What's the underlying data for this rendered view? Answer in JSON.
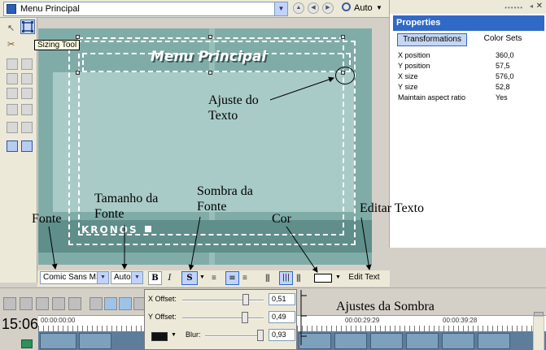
{
  "toolbar": {
    "menu_select_value": "Menu Principal",
    "zoom_value": "Auto"
  },
  "tooltip": "Sizing Tool",
  "canvas": {
    "title_text": "Menu Principal",
    "footer_logo": "KRONOS"
  },
  "properties": {
    "title": "Properties",
    "tabs": [
      "Transformations",
      "Color Sets"
    ],
    "rows": [
      {
        "name": "X position",
        "value": "360,0"
      },
      {
        "name": "Y position",
        "value": "57,5"
      },
      {
        "name": "X size",
        "value": "576,0"
      },
      {
        "name": "Y size",
        "value": "52,8"
      },
      {
        "name": "Maintain aspect ratio",
        "value": "Yes"
      }
    ]
  },
  "text_toolbar": {
    "font": "Comic Sans MS",
    "size": "Auto",
    "bold": "B",
    "italic": "I",
    "shadow": "S",
    "edit_text": "Edit Text"
  },
  "shadow_panel": {
    "x_offset_label": "X Offset:",
    "x_offset_value": "0,51",
    "y_offset_label": "Y Offset:",
    "y_offset_value": "0,49",
    "blur_label": "Blur:",
    "blur_value": "0,93"
  },
  "annotations": {
    "ajuste_texto": "Ajuste do\nTexto",
    "tamanho_fonte": "Tamanho da\nFonte",
    "sombra_fonte": "Sombra da\nFonte",
    "fonte": "Fonte",
    "cor": "Cor",
    "editar_texto": "Editar Texto",
    "ajustes_sombra": "Ajustes da Sombra"
  },
  "timeline": {
    "time_display": "15:06",
    "ruler_labels": [
      "00:00:00:00",
      "00:00:29:29",
      "00:00:39:28"
    ]
  },
  "colors": {
    "canvas_bg": "#80aca8",
    "panel_header": "#3169c6"
  }
}
